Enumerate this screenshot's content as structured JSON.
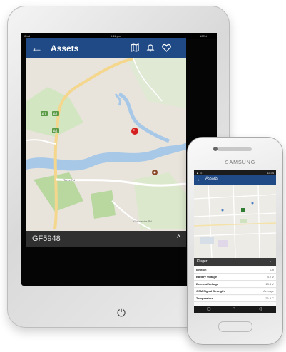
{
  "tablet": {
    "status": {
      "left": "iPad",
      "center": "9:11 pm",
      "right": "100%"
    },
    "header": {
      "back_icon": "←",
      "title": "Assets",
      "icons": [
        "map-icon",
        "bell-icon",
        "heart-icon"
      ]
    },
    "map": {
      "road_labels": [
        "A1",
        "A1",
        "A1",
        "Taree Rd",
        "Gloucester Rd"
      ],
      "marker": "red-asset-pin",
      "colors": {
        "land": "#e8e4dc",
        "water": "#a8c8e8",
        "park": "#b8d8a0",
        "road": "#f4d68c"
      }
    },
    "footer": {
      "asset_id": "GF5948",
      "expand_icon": "^"
    },
    "power_icon": "⏻"
  },
  "phone": {
    "brand": "SAMSUNG",
    "status": {
      "left": "▲ ⊙",
      "right": "12:34"
    },
    "header": {
      "back_icon": "←",
      "title": "Assets"
    },
    "sheet": {
      "title": "Kluger",
      "expand_icon": "⌄",
      "rows": [
        {
          "label": "Ignition",
          "value": "On"
        },
        {
          "label": "Battery Voltage",
          "value": "4.2 V"
        },
        {
          "label": "External Voltage",
          "value": "13.8 V"
        },
        {
          "label": "GSM Signal Strength",
          "value": "Average"
        },
        {
          "label": "Temperature",
          "value": "25.3 C"
        }
      ]
    },
    "nav": [
      "▢",
      "○",
      "◁"
    ]
  },
  "colors": {
    "header_blue": "#1f4a86",
    "footer_dark": "#303030",
    "pin_red": "#d42020"
  }
}
